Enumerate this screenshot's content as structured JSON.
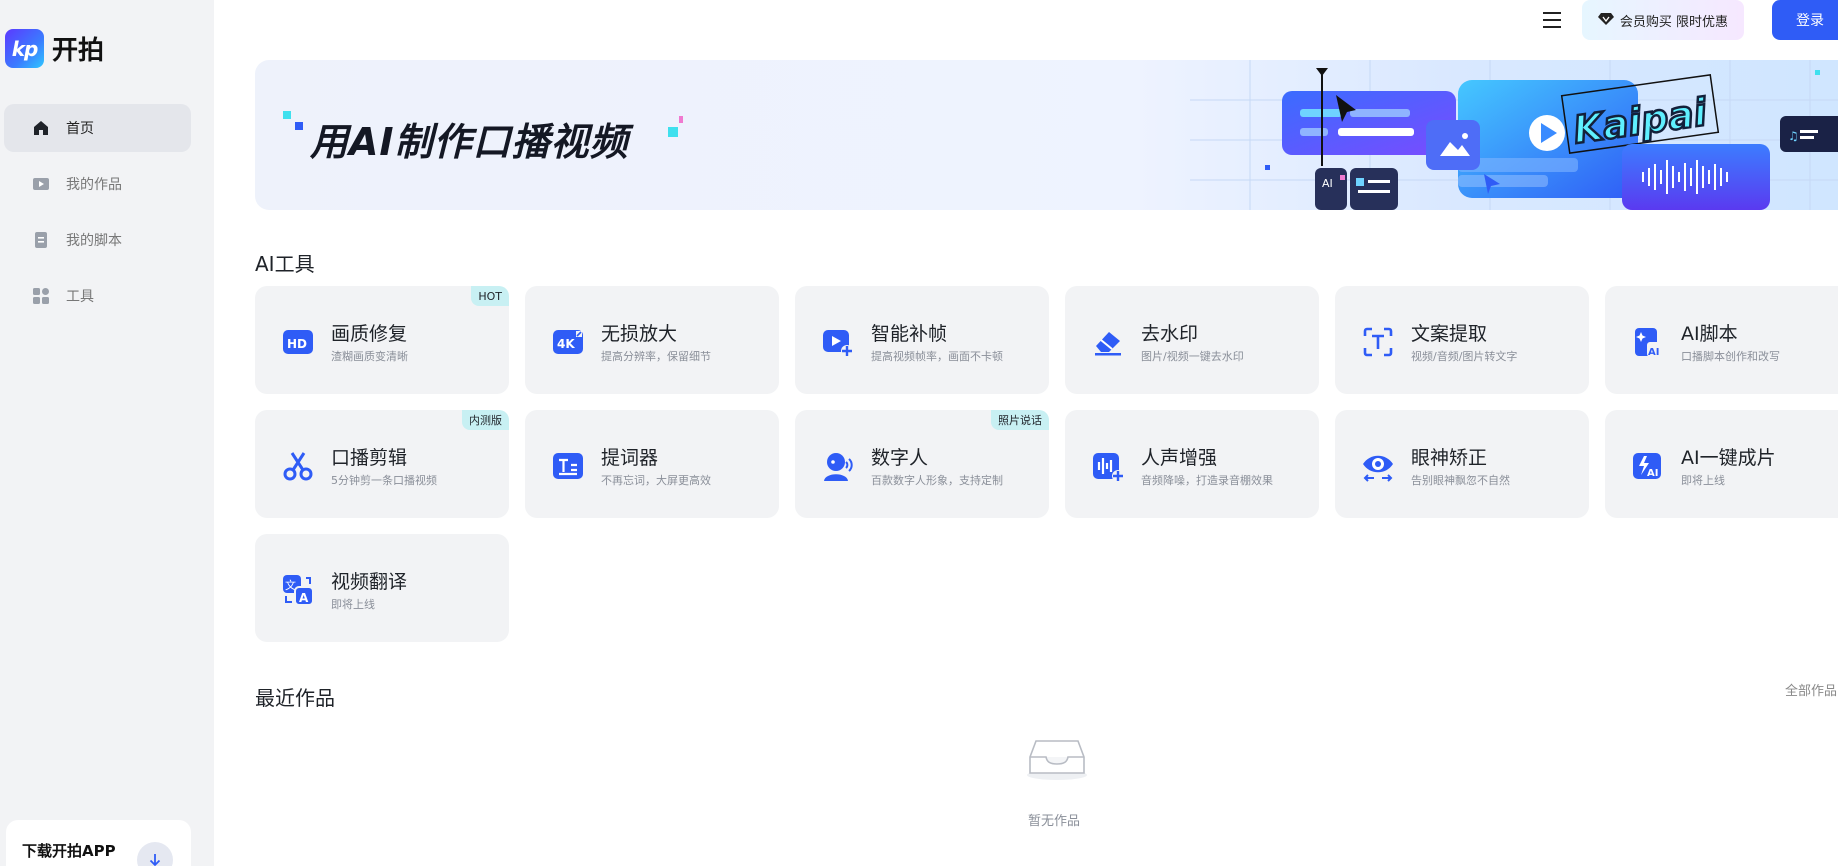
{
  "app": {
    "logo_mark": "kp",
    "logo_text": "开拍"
  },
  "sidebar": {
    "items": [
      {
        "label": "首页",
        "icon": "home-icon",
        "active": true
      },
      {
        "label": "我的作品",
        "icon": "video-icon",
        "active": false
      },
      {
        "label": "我的脚本",
        "icon": "script-icon",
        "active": false
      },
      {
        "label": "工具",
        "icon": "grid-icon",
        "active": false
      }
    ],
    "download_label": "下载开拍APP"
  },
  "header": {
    "vip_label": "会员购买 限时优惠",
    "login_label": "登录"
  },
  "banner": {
    "title": "用AI制作口播视频",
    "art_text": "Kaipai"
  },
  "tools_section": {
    "title": "AI工具",
    "tools": [
      {
        "name": "画质修复",
        "desc": "渣糊画质变清晰",
        "icon": "hd-icon",
        "badge": "HOT"
      },
      {
        "name": "无损放大",
        "desc": "提高分辨率，保留细节",
        "icon": "4k-icon",
        "badge": ""
      },
      {
        "name": "智能补帧",
        "desc": "提高视频帧率，画面不卡顿",
        "icon": "frame-icon",
        "badge": ""
      },
      {
        "name": "去水印",
        "desc": "图片/视频一键去水印",
        "icon": "eraser-icon",
        "badge": ""
      },
      {
        "name": "文案提取",
        "desc": "视频/音频/图片转文字",
        "icon": "text-extract-icon",
        "badge": ""
      },
      {
        "name": "AI脚本",
        "desc": "口播脚本创作和改写",
        "icon": "ai-script-icon",
        "badge": ""
      },
      {
        "name": "口播剪辑",
        "desc": "5分钟剪一条口播视频",
        "icon": "scissors-icon",
        "badge": "内测版"
      },
      {
        "name": "提词器",
        "desc": "不再忘词，大屏更高效",
        "icon": "teleprompter-icon",
        "badge": ""
      },
      {
        "name": "数字人",
        "desc": "百款数字人形象，支持定制",
        "icon": "avatar-icon",
        "badge": "照片说话"
      },
      {
        "name": "人声增强",
        "desc": "音频降噪，打造录音棚效果",
        "icon": "voice-icon",
        "badge": ""
      },
      {
        "name": "眼神矫正",
        "desc": "告别眼神飘忽不自然",
        "icon": "eye-icon",
        "badge": ""
      },
      {
        "name": "AI一键成片",
        "desc": "即将上线",
        "icon": "ai-film-icon",
        "badge": ""
      },
      {
        "name": "视频翻译",
        "desc": "即将上线",
        "icon": "translate-icon",
        "badge": ""
      }
    ]
  },
  "recent_section": {
    "title": "最近作品",
    "all_label": "全部作品",
    "empty_text": "暂无作品"
  },
  "colors": {
    "accent": "#2f5cf6",
    "sidebar_bg": "#f2f3f5",
    "card_bg": "#f2f3f5",
    "badge_bg": "#c8f0f3"
  }
}
